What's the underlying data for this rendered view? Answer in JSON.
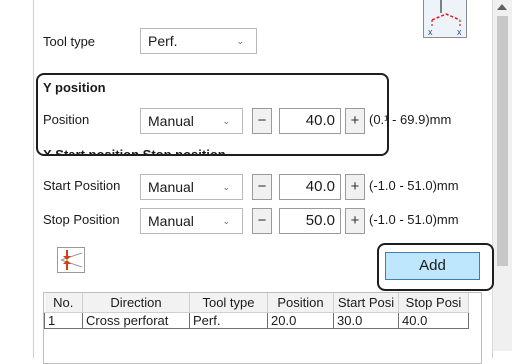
{
  "tool_type": {
    "label": "Tool type",
    "value": "Perf."
  },
  "y_position": {
    "heading": "Y position",
    "position_label": "Position",
    "mode": "Manual",
    "value": "40.0",
    "range": "(0.¹ - 69.9)mm"
  },
  "hidden_heading": "X Start position   Stop position",
  "start_position": {
    "label": "Start Position",
    "mode": "Manual",
    "value": "40.0",
    "range": "(-1.0 - 51.0)mm"
  },
  "stop_position": {
    "label": "Stop Position",
    "mode": "Manual",
    "value": "50.0",
    "range": "(-1.0 - 51.0)mm"
  },
  "buttons": {
    "minus": "−",
    "plus": "+",
    "add": "Add"
  },
  "table": {
    "headers": [
      "No.",
      "Direction",
      "Tool type",
      "Position",
      "Start Posi",
      "Stop Posi"
    ],
    "rows": [
      [
        "1",
        "Cross perforat",
        "Perf.",
        "20.0",
        "30.0",
        "40.0"
      ]
    ]
  },
  "icons": {
    "tool_preview": "perforation-preview-icon",
    "reverse": "reverse-direction-icon",
    "dropdown": "chevron-down-icon"
  },
  "colors": {
    "add_button_bg": "#bee6fd",
    "add_button_border": "#3c7fb1",
    "highlight": "#1e1e1e",
    "preview_line": "#e02020",
    "preview_x": "#1f4fa0"
  }
}
